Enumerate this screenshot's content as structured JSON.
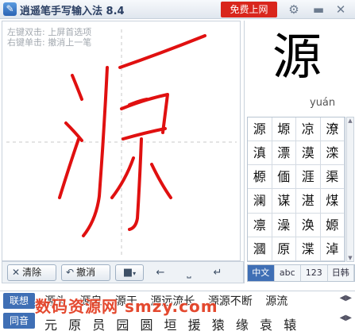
{
  "title_bar": {
    "app_icon": "pen-app-icon",
    "title": "逍遥笔手写输入法 8.4",
    "free_online_label": "免费上网",
    "settings_icon": "gear-icon",
    "minimize_icon": "minimize-icon",
    "close_icon": "close-icon"
  },
  "write_area": {
    "hint_double_click": "左键双击: 上屏首选项",
    "hint_right_click": "右键单击: 撤消上一笔",
    "stroke_color": "#e01010"
  },
  "toolbar": {
    "clear_label": "清除",
    "undo_label": "撤消",
    "camera_icon": "camera-icon",
    "backspace_key": "←",
    "space_key": "⎵",
    "enter_key": "↵"
  },
  "preview": {
    "char": "源",
    "pinyin": "yuán"
  },
  "candidates": [
    "源",
    "塬",
    "凉",
    "潦",
    "滇",
    "漂",
    "漠",
    "滦",
    "榞",
    "偭",
    "涯",
    "渠",
    "澜",
    "谋",
    "湛",
    "煤",
    "凛",
    "澡",
    "涣",
    "嫄",
    "漍",
    "原",
    "渫",
    "淖"
  ],
  "mode_tabs": [
    "中文",
    "abc",
    "123",
    "日韩"
  ],
  "assoc_label": "联想",
  "assoc_words": [
    "源头",
    "源泉",
    "源于",
    "源远流长",
    "源源不断",
    "源流"
  ],
  "homophone_label": "同音",
  "homophone_chars": [
    "元",
    "原",
    "员",
    "园",
    "圆",
    "垣",
    "援",
    "猿",
    "缘",
    "袁",
    "辕"
  ],
  "watermark": "数码资源网 smzy.com",
  "accent_color": "#3f6fb5"
}
